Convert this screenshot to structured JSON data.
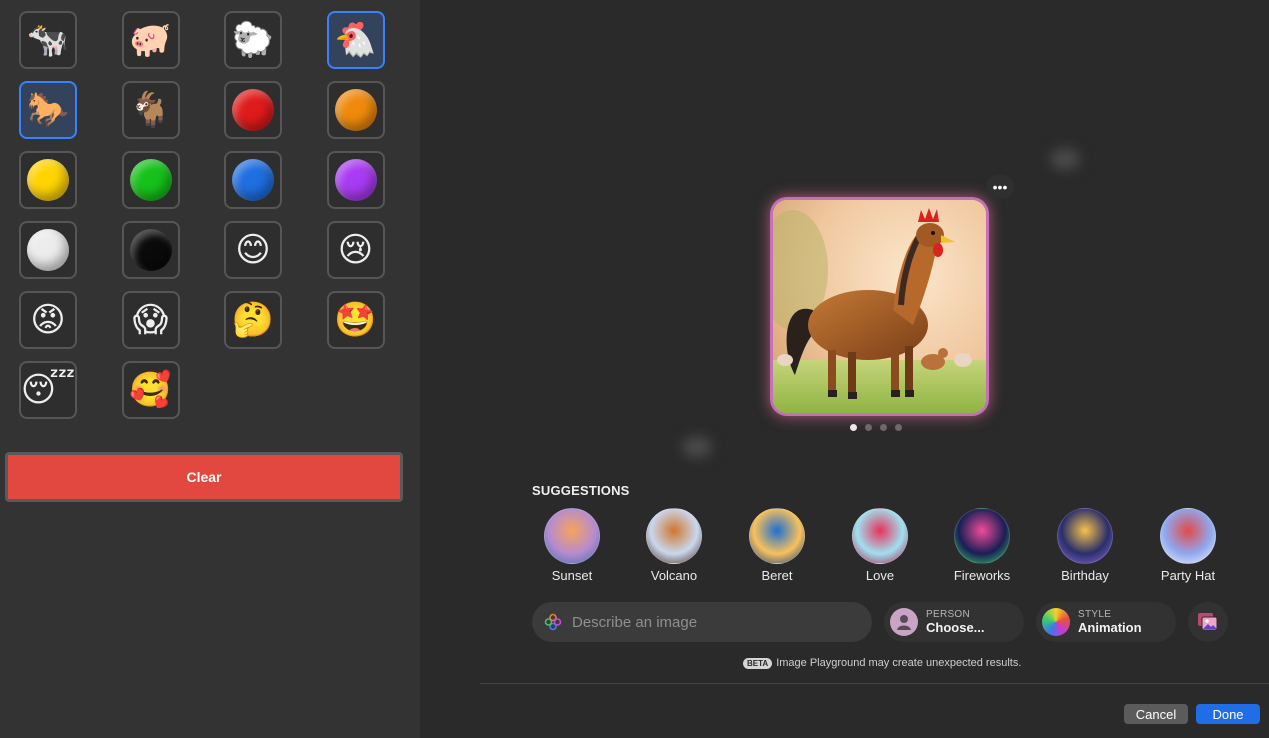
{
  "emoji_palette": {
    "cells": [
      {
        "name": "cow",
        "glyph": "🐄"
      },
      {
        "name": "pig",
        "glyph": "🐖"
      },
      {
        "name": "sheep",
        "glyph": "🐑"
      },
      {
        "name": "chicken",
        "glyph": "🐔",
        "selected": true
      },
      {
        "name": "horse",
        "glyph": "🐎",
        "selected": true
      },
      {
        "name": "goat",
        "glyph": "🐐"
      },
      {
        "name": "red-circle",
        "color": "#e01b1b"
      },
      {
        "name": "orange-circle",
        "color": "#ef8a0c"
      },
      {
        "name": "yellow-circle",
        "color": "#ffd400"
      },
      {
        "name": "green-circle",
        "color": "#16c21a"
      },
      {
        "name": "blue-circle",
        "color": "#1f6fe0"
      },
      {
        "name": "purple-circle",
        "color": "#a93bf2"
      },
      {
        "name": "white-circle",
        "color": "#ececec"
      },
      {
        "name": "black-circle",
        "color": "#0a0a0a"
      },
      {
        "name": "smiling-face",
        "glyph": "😊"
      },
      {
        "name": "crying-face",
        "glyph": "😢"
      },
      {
        "name": "angry-face",
        "glyph": "😡"
      },
      {
        "name": "screaming-face",
        "glyph": "😱"
      },
      {
        "name": "thinking-face",
        "glyph": "🤔"
      },
      {
        "name": "star-struck-face",
        "glyph": "🤩"
      },
      {
        "name": "sleeping-face",
        "glyph": "😴"
      },
      {
        "name": "smiling-face-with-hearts",
        "glyph": "🥰"
      }
    ],
    "clear_label": "Clear"
  },
  "preview": {
    "more_label": "•••",
    "subject": "rooster-horse"
  },
  "suggestions": {
    "title": "SUGGESTIONS",
    "items": [
      {
        "label": "Sunset",
        "colors": [
          "#b58bd0",
          "#f7a35c",
          "#3d6fa8"
        ]
      },
      {
        "label": "Volcano",
        "colors": [
          "#c9d8ee",
          "#d1762e",
          "#4a2516"
        ]
      },
      {
        "label": "Beret",
        "colors": [
          "#f8c15c",
          "#1f6fd0",
          "#0e3a86"
        ]
      },
      {
        "label": "Love",
        "colors": [
          "#9fe0f0",
          "#e8335a",
          "#b01740"
        ]
      },
      {
        "label": "Fireworks",
        "colors": [
          "#1a1f55",
          "#f24b9b",
          "#37d26a"
        ]
      },
      {
        "label": "Birthday",
        "colors": [
          "#2a2f6b",
          "#f7c24a",
          "#8f6ad9"
        ]
      },
      {
        "label": "Party Hat",
        "colors": [
          "#8fa8ef",
          "#e24a4a",
          "#f4f4f4"
        ]
      }
    ]
  },
  "prompt": {
    "placeholder": "Describe an image"
  },
  "person_chip": {
    "caption": "PERSON",
    "value": "Choose..."
  },
  "style_chip": {
    "caption": "STYLE",
    "value": "Animation"
  },
  "disclaimer": {
    "badge": "BETA",
    "text": "Image Playground may create unexpected results."
  },
  "actions": {
    "cancel": "Cancel",
    "done": "Done"
  }
}
